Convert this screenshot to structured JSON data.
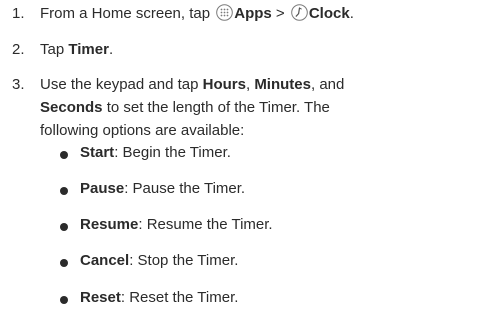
{
  "steps": [
    {
      "number": "1.",
      "pre": "From a Home screen, tap ",
      "apps_label": "Apps",
      "sep": " > ",
      "clock_label": "Clock",
      "end": ".",
      "apps_icon": "apps-grid-icon",
      "clock_icon": "clock-icon"
    },
    {
      "number": "2.",
      "pre": "Tap ",
      "bold": "Timer",
      "end": "."
    },
    {
      "number": "3.",
      "pre": "Use the keypad and tap ",
      "b1": "Hours",
      "s1": ", ",
      "b2": "Minutes",
      "s2": ", and",
      "b3": "Seconds",
      "rest1": " to set the length of the Timer. The",
      "rest2": "following options are available:"
    }
  ],
  "options": [
    {
      "term": "Start",
      "desc": ": Begin the Timer."
    },
    {
      "term": "Pause",
      "desc": ": Pause the Timer."
    },
    {
      "term": "Resume",
      "desc": ": Resume the Timer."
    },
    {
      "term": "Cancel",
      "desc": ": Stop the Timer."
    },
    {
      "term": "Reset",
      "desc": ": Reset the Timer."
    }
  ]
}
